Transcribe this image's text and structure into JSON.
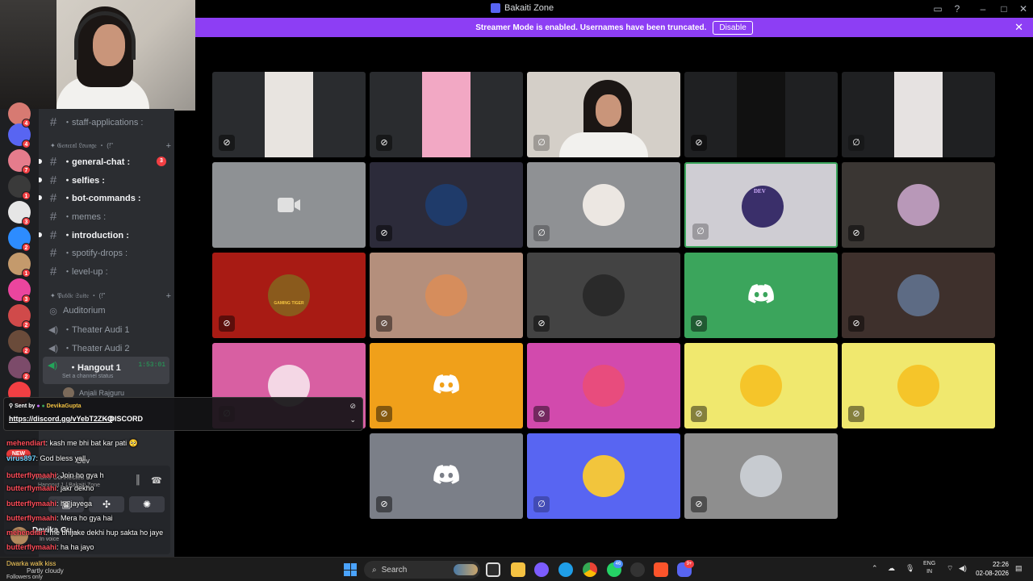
{
  "window": {
    "title": "Bakaiti Zone"
  },
  "banner": {
    "text": "Streamer Mode is enabled. Usernames have been truncated.",
    "button": "Disable"
  },
  "server_rail": {
    "badges": [
      "4",
      "4",
      "7",
      "1",
      "3",
      "2",
      "1",
      "3",
      "2",
      "2",
      "2"
    ]
  },
  "channels": {
    "items": [
      {
        "name": "・staff-applications :",
        "unread": false
      },
      {
        "name": "・general-chat :",
        "unread": true,
        "count": "3"
      },
      {
        "name": "・selfies :",
        "unread": true
      },
      {
        "name": "・bot-commands :",
        "unread": true
      },
      {
        "name": "・memes :",
        "unread": false
      },
      {
        "name": "・introduction :",
        "unread": true
      },
      {
        "name": "・spotify-drops :",
        "unread": false
      },
      {
        "name": "・level-up :",
        "unread": false
      }
    ],
    "categories": [
      "✦ 𝔊𝔢𝔫𝔢𝔯𝔞𝔩 𝔏𝔬𝔲𝔫𝔤𝔢 ・ (!\"",
      "✦ 𝔓𝔲𝔟𝔩𝔦𝔠 𝔖𝔲𝔦𝔱𝔢 ・ (!\""
    ],
    "voice": [
      {
        "name": "Auditorium"
      },
      {
        "name": "・Theater Audi 1"
      },
      {
        "name": "・Theater Audi 2"
      }
    ],
    "hangout": {
      "name": "・Hangout 1",
      "time": "1:53:01",
      "status": "Set a channel status"
    },
    "member": "Anjali Rajguru"
  },
  "sent_by": {
    "prefix": "Sent by",
    "user": "DevikaGupta",
    "link": "https://discord.gg/vYebT2ZKQ",
    "brand": "- DISCORD"
  },
  "chat": [
    {
      "user": "mehendiart",
      "text": "kash me bhi bat kar pati 🥺"
    },
    {
      "user": "virus897",
      "text": "God bless yall"
    },
    {
      "user": "butterflymaahi",
      "text": "Join ho gya h"
    },
    {
      "user": "butterflymaahi",
      "text": "jakr dekho"
    },
    {
      "user": "butterflymaahi",
      "text": "ho jayega"
    },
    {
      "user": "butterflymaahi",
      "text": "Mera ho gya hai"
    },
    {
      "user": "mehendiart",
      "text": "me bhijake dekhi hup sakta ho jaye"
    },
    {
      "user": "butterflymaahi",
      "text": "ha ha jayo"
    }
  ],
  "voice_panel": {
    "new_label": "NEW",
    "user_dev": "Dev",
    "connection": "Video Connected",
    "channel_path": "Hangout 1 / Bakaiti Zone",
    "self_name": "Devika Gu...",
    "self_status": "In voice"
  },
  "tiles": [
    {
      "kind": "video",
      "bg": "#2a2c2f",
      "video": "#e8e4e0",
      "muted": true
    },
    {
      "kind": "video",
      "bg": "#2a2c2f",
      "video": "#f2a8c4",
      "muted": true
    },
    {
      "kind": "video",
      "bg": "#2a2c2f",
      "video": "#d4cfc8",
      "muted": false
    },
    {
      "kind": "video",
      "bg": "#1f2022",
      "video": "#111111",
      "muted": true
    },
    {
      "kind": "video",
      "bg": "#1f2022",
      "video": "#e6e2e1",
      "muted": false
    },
    {
      "kind": "camera",
      "bg": "#8e9194",
      "muted": false
    },
    {
      "kind": "avatar",
      "bg": "#2c2b3a",
      "avatar": "#1f3b6a",
      "muted": true
    },
    {
      "kind": "avatar",
      "bg": "#8f9194",
      "avatar": "#ece7e2",
      "muted": false
    },
    {
      "kind": "avatar",
      "bg": "#cfcdd3",
      "avatar": "#3a2f6a",
      "muted": false,
      "speaking": true
    },
    {
      "kind": "avatar",
      "bg": "#3a3633",
      "avatar": "#b898b8",
      "muted": true
    },
    {
      "kind": "avatar",
      "bg": "#a81b14",
      "avatar": "#8a5a1c",
      "muted": true
    },
    {
      "kind": "avatar",
      "bg": "#b48f7c",
      "avatar": "#d68d5c",
      "muted": true
    },
    {
      "kind": "avatar",
      "bg": "#434343",
      "avatar": "#2a2a2a",
      "muted": true
    },
    {
      "kind": "discord",
      "bg": "#3ba55c",
      "muted": true
    },
    {
      "kind": "avatar",
      "bg": "#3e302c",
      "avatar": "#5d6b84",
      "muted": true
    },
    {
      "kind": "avatar",
      "bg": "#d85fa2",
      "avatar": "#f4d7e5",
      "muted": false
    },
    {
      "kind": "discord",
      "bg": "#f0a01a",
      "muted": true
    },
    {
      "kind": "avatar",
      "bg": "#d24aad",
      "avatar": "#e84c7d",
      "muted": true
    },
    {
      "kind": "avatar",
      "bg": "#f0e86e",
      "avatar": "#f5c52a",
      "muted": true
    },
    {
      "kind": "avatar",
      "bg": "#f0e86e",
      "avatar": "#f5c52a",
      "muted": true
    },
    {
      "kind": "discord",
      "bg": "#7b7f88",
      "muted": true
    },
    {
      "kind": "avatar",
      "bg": "#5865f2",
      "avatar": "#f2c53c",
      "muted": false
    },
    {
      "kind": "avatar",
      "bg": "#8e8e8e",
      "avatar": "#c7cbd0",
      "muted": true
    }
  ],
  "avatar_texts": {
    "dev": "DEV",
    "gaming": "GAMING TIGER"
  },
  "taskbar": {
    "weather_line1": "Dwarka walk kiss",
    "weather_line2": "Partly cloudy",
    "weather_line3": "Followers only",
    "search": "Search",
    "badge_whatsapp": "46",
    "badge_discord": "9+",
    "lang": "ENG",
    "region": "IN",
    "time": "22:26",
    "date": "02-08-2026"
  }
}
